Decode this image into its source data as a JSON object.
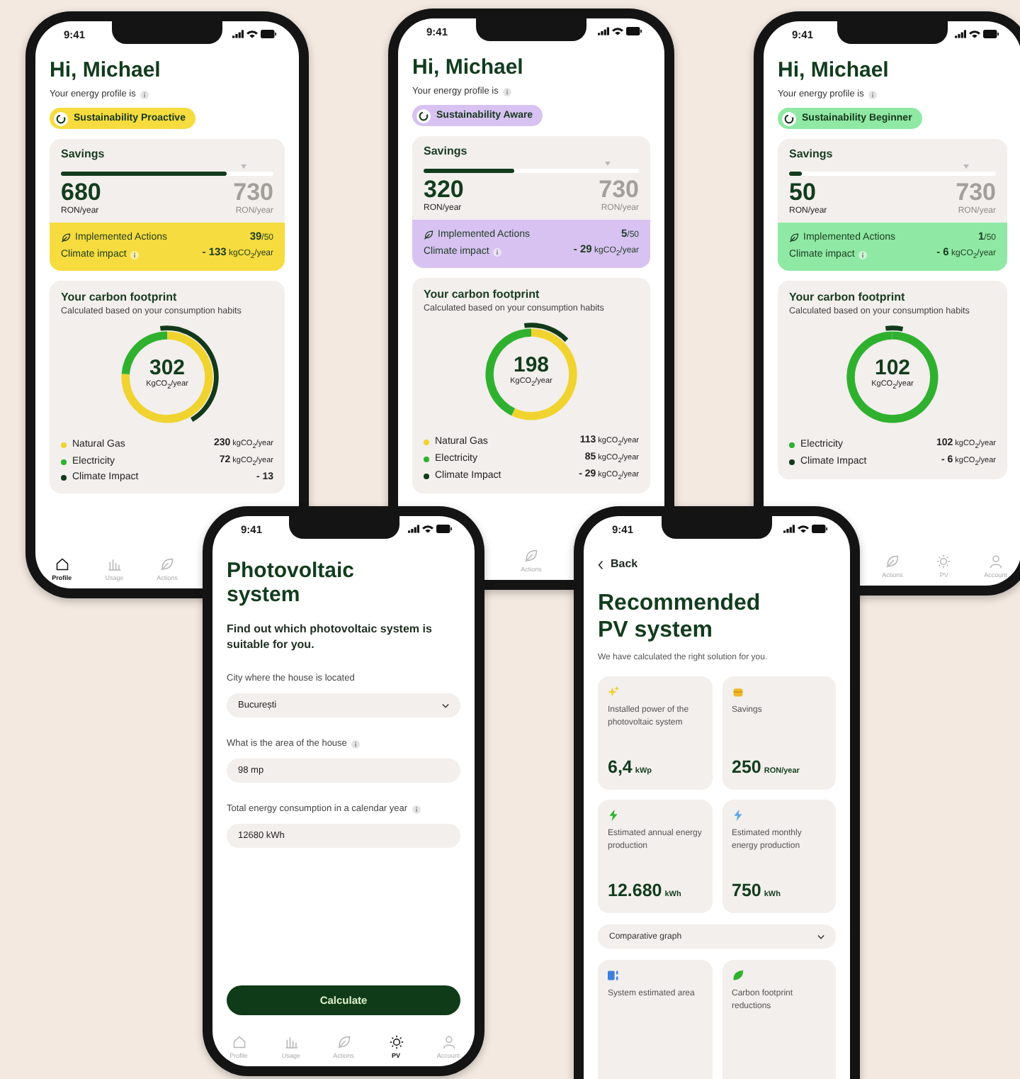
{
  "phones": [
    {
      "kind": "dashboard",
      "time": "9:41",
      "greeting": "Hi, Michael",
      "profile_label": "Your energy profile is",
      "badge": {
        "label": "Sustainability Proactive",
        "color": "#f6dc3e"
      },
      "savings": {
        "title": "Savings",
        "value": "680",
        "unit": "RON/year",
        "target": "730",
        "target_unit": "RON/year",
        "level": 0.78
      },
      "actions": {
        "label": "Implemented Actions",
        "count": "**39**/50"
      },
      "impact": {
        "label": "Climate impact",
        "value": "**- 133** kgCO$_{2}$/year"
      },
      "footprint": {
        "title": "Your carbon footprint",
        "subtitle": "Calculated based on your consumption habits",
        "total": "302",
        "unit": "KgCO$_{2}$/year",
        "legend": [
          {
            "value": "**230** kgCO$_{2}$/year",
            "color": "#f0d32e"
          },
          {
            "value": "**72** kgCO$_{2}$/year",
            "color": "#2fb12f"
          },
          {
            "name": "Climate Impact",
            "value": "**- 13**",
            "color": "#12391a"
          }
        ],
        "chart_data": {
          "type": "donut",
          "categories": [
            "Natural Gas",
            "Electricity"
          ],
          "values": [
            76.2,
            23.8
          ]
        }
      },
      "nav": [
        {
          "label": "Profile",
          "kind": "home",
          "selected": true
        },
        {
          "label": "Usage",
          "kind": "bars",
          "selected": false
        },
        {
          "label": "Actions",
          "kind": "leaf",
          "selected": false
        }
      ]
    },
    {
      "kind": "dashboard",
      "time": "9:41",
      "greeting": "Hi, Michael",
      "profile_label": "Your energy profile is",
      "badge": {
        "label": "Sustainability Aware",
        "color": "#d8c2f2"
      },
      "savings": {
        "title": "Savings",
        "value": "320",
        "unit": "RON/year",
        "target": "730",
        "target_unit": "RON/year",
        "level": 0.42
      },
      "actions": {
        "label": "Implemented Actions",
        "count": "**5**/50"
      },
      "impact": {
        "label": "Climate impact",
        "value": "**- 29** kgCO$_{2}$/year"
      },
      "footprint": {
        "title": "Your carbon footprint",
        "subtitle": "Calculated based on your consumption habits",
        "total": "198",
        "unit": "KgCO$_{2}$/year",
        "legend": [
          {
            "value": "**113** kgCO$_{2}$/year",
            "color": "#f0d32e"
          },
          {
            "value": "**85** kgCO$_{2}$/year",
            "color": "#2fb12f"
          },
          {
            "name": "Climate Impact",
            "value": "**- 29** kgCO$_{2}$/year",
            "color": "#12391a"
          }
        ],
        "chart_data": {
          "type": "donut",
          "categories": [
            "Natural Gas",
            "Electricity"
          ],
          "values": [
            57.1,
            42.9
          ]
        }
      },
      "nav": [
        {
          "label": "Actions",
          "kind": "leaf",
          "selected": false
        }
      ]
    },
    {
      "kind": "dashboard",
      "time": "9:41",
      "greeting": "Hi, Michael",
      "profile_label": "Your energy profile is",
      "badge": {
        "label": "Sustainability Beginner",
        "color": "#8fe9a4"
      },
      "savings": {
        "title": "Savings",
        "value": "50",
        "unit": "RON/year",
        "target": "730",
        "target_unit": "RON/year",
        "level": 0.06
      },
      "actions": {
        "label": "Implemented Actions",
        "count": "**1**/50"
      },
      "impact": {
        "label": "Climate impact",
        "value": "**- 6** kgCO$_{2}$/year"
      },
      "footprint": {
        "title": "Your carbon footprint",
        "subtitle": "Calculated based on your consumption habits",
        "total": "102",
        "unit": "KgCO$_{2}$/year",
        "legend": [
          {
            "name": "Electricity",
            "value": "**102** kgCO$_{2}$/year",
            "color": "#2fb12f"
          },
          {
            "name": "Climate Impact",
            "value": "**- 6** kgCO$_{2}$/year",
            "color": "#12391a"
          }
        ]
      },
      "nav": [
        {
          "label": "Actions",
          "kind": "leaf",
          "selected": false
        },
        {
          "label": "PV",
          "kind": "sun",
          "selected": false
        },
        {
          "label": "Account",
          "kind": "person",
          "selected": false
        }
      ]
    },
    {
      "kind": "form",
      "time": "9:41",
      "title": "Photovoltaic system",
      "intro": "Find out which photovoltaic system is suitable for you.",
      "fields": [
        {
          "label": "City where the house is located",
          "value": "București",
          "kind": "select",
          "info": false
        },
        {
          "label": "What is the area of the house",
          "value": "98 mp",
          "kind": "text",
          "info": true
        },
        {
          "label": "Total energy consumption in a calendar year",
          "value": "12680 kWh",
          "kind": "text",
          "info": true
        }
      ],
      "button": "Calculate",
      "nav": [
        {
          "label": "Profile",
          "kind": "home",
          "selected": false
        },
        {
          "label": "Usage",
          "kind": "bars",
          "selected": false
        },
        {
          "label": "Actions",
          "kind": "leaf",
          "selected": false
        },
        {
          "label": "PV",
          "kind": "sun",
          "selected": true
        },
        {
          "label": "Account",
          "kind": "person",
          "selected": false
        }
      ]
    },
    {
      "kind": "result",
      "time": "9:41",
      "back": "Back",
      "title": "Recommended PV system",
      "subtitle": "We have calculated the right solution for you.",
      "cards": [
        {
          "kind": "sparkle",
          "label": "Installed power of the photovoltaic system",
          "value": "6,4",
          "unit": "kWp"
        },
        {
          "kind": "coin",
          "label": "Savings",
          "value": "250",
          "unit": "RON/year"
        },
        {
          "kind": "bolt-green",
          "label": "Estimated annual energy production",
          "value": "12.680",
          "unit": "kWh"
        },
        {
          "kind": "bolt-blue",
          "label": "Estimated monthly energy production",
          "value": "750",
          "unit": "kWh"
        }
      ],
      "dropdown": "Comparative graph",
      "more_cards": [
        {
          "kind": "area",
          "label": "System estimated area"
        },
        {
          "kind": "leaf",
          "label": "Carbon footprint reductions"
        }
      ]
    }
  ]
}
